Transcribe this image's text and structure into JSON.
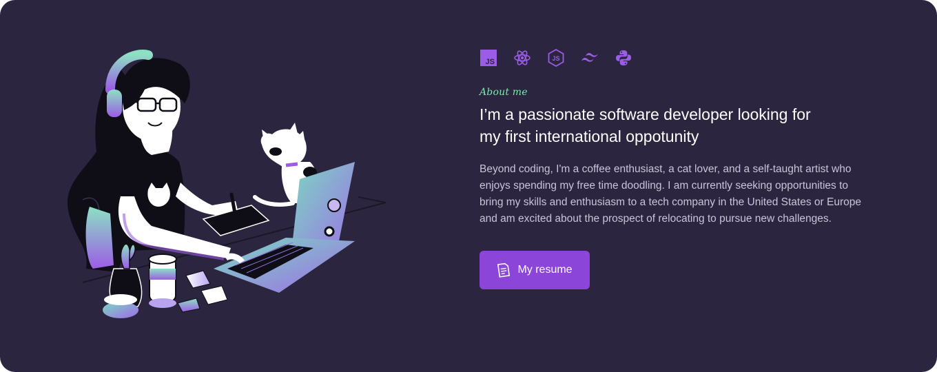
{
  "about": {
    "eyebrow": "About me",
    "headline_line1": "I’m a passionate software developer looking for",
    "headline_line2": "my first international oppotunity",
    "bio_lines": [
      "Beyond coding, I'm a coffee enthusiast, a cat lover, and a self-taught artist who",
      "enjoys spending my free time doodling. I am currently seeking opportunities to",
      "bring my skills and enthusiasm to a tech company in the United States or Europe",
      "and am excited about the prospect of relocating to pursue new challenges."
    ],
    "resume_label": "My resume"
  },
  "tech_icons": [
    "javascript-icon",
    "react-icon",
    "nodejs-icon",
    "tailwind-icon",
    "python-icon"
  ],
  "icon_labels": {
    "js": "JS",
    "node": "JS"
  },
  "colors": {
    "background": "#2b2540",
    "accent": "#8b45d9",
    "accent_light": "#9b5de5",
    "eyebrow": "#7de8b0",
    "text": "#ffffff",
    "muted": "#c9c5d6"
  }
}
